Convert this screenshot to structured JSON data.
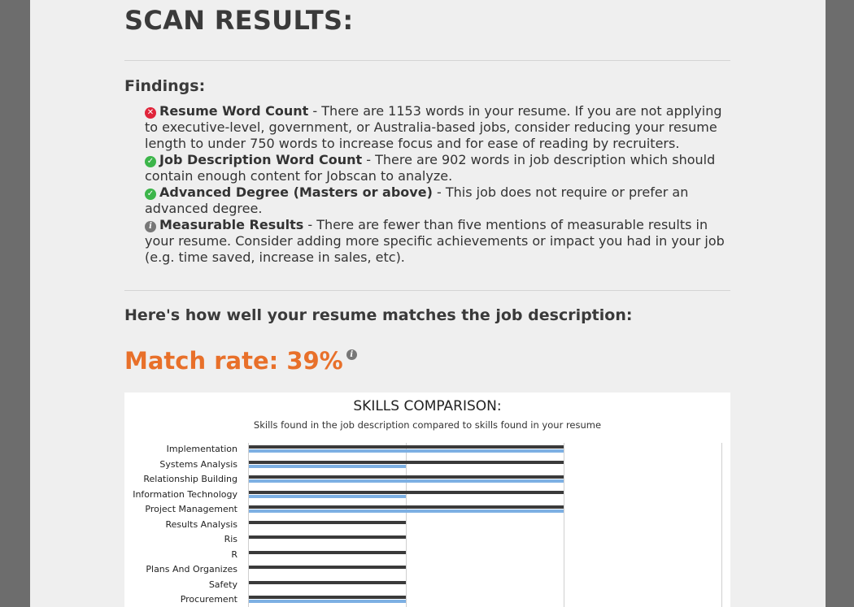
{
  "title": "SCAN RESULTS:",
  "findings": {
    "heading": "Findings:",
    "items": [
      {
        "status": "error",
        "icon": "x-circle-icon",
        "name": "Resume Word Count",
        "text": " - There are 1153 words in your resume. If you are not applying to executive-level, government, or Australia-based jobs, consider reducing your resume length to under 750 words to increase focus and for ease of reading by recruiters."
      },
      {
        "status": "ok",
        "icon": "check-circle-icon",
        "name": "Job Description Word Count",
        "text": " - There are 902 words in job description which should contain enough content for Jobscan to analyze."
      },
      {
        "status": "ok",
        "icon": "check-circle-icon",
        "name": "Advanced Degree (Masters or above)",
        "text": " - This job does not require or prefer an advanced degree."
      },
      {
        "status": "info",
        "icon": "info-circle-icon",
        "name": "Measurable Results",
        "text": " - There are fewer than five mentions of measurable results in your resume. Consider adding more specific achievements or impact you had in your job (e.g. time saved, increase in sales, etc)."
      }
    ]
  },
  "match": {
    "heading": "Here's how well your resume matches the job description:",
    "rate_label": "Match rate: 39%"
  },
  "colors": {
    "accent_orange": "#e8702a",
    "job_bar": "#3a3a3a",
    "resume_bar": "#7db0e3",
    "error_icon": "#e0243a",
    "ok_icon": "#3cb54a"
  },
  "chart_data": {
    "type": "bar",
    "orientation": "horizontal",
    "title": "SKILLS COMPARISON:",
    "subtitle": "Skills found in the job description compared to skills found in your resume",
    "categories": [
      "Implementation",
      "Systems Analysis",
      "Relationship Building",
      "Information Technology",
      "Project Management",
      "Results Analysis",
      "Ris",
      "R",
      "Plans And Organizes",
      "Safety",
      "Procurement"
    ],
    "series": [
      {
        "values": [
          2,
          2,
          2,
          2,
          2,
          1,
          1,
          1,
          1,
          1,
          1
        ]
      },
      {
        "values": [
          2,
          1,
          2,
          1,
          2,
          0,
          0,
          0,
          0,
          0,
          1
        ]
      }
    ],
    "xlim": [
      0,
      3
    ],
    "grid": true
  }
}
